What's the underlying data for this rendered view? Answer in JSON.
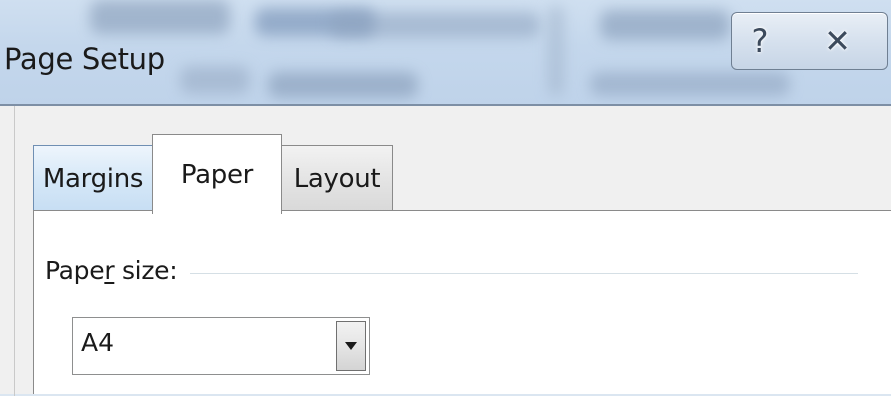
{
  "window": {
    "title": "Page Setup",
    "help_glyph": "?",
    "close_glyph": "✕"
  },
  "tabs": [
    {
      "label": "Margins",
      "state": "inactive"
    },
    {
      "label": "Paper",
      "state": "selected"
    },
    {
      "label": "Layout",
      "state": "inactive"
    }
  ],
  "paper_tab": {
    "group_label_before": "Pape",
    "group_label_mnemonic": "r",
    "group_label_after": " size:",
    "paper_size_value": "A4"
  },
  "colors": {
    "titlebar": "#c4d7ec",
    "dialog_face": "#f0f0f0",
    "tab_hover": "#d6e8f8",
    "panel": "#ffffff"
  }
}
